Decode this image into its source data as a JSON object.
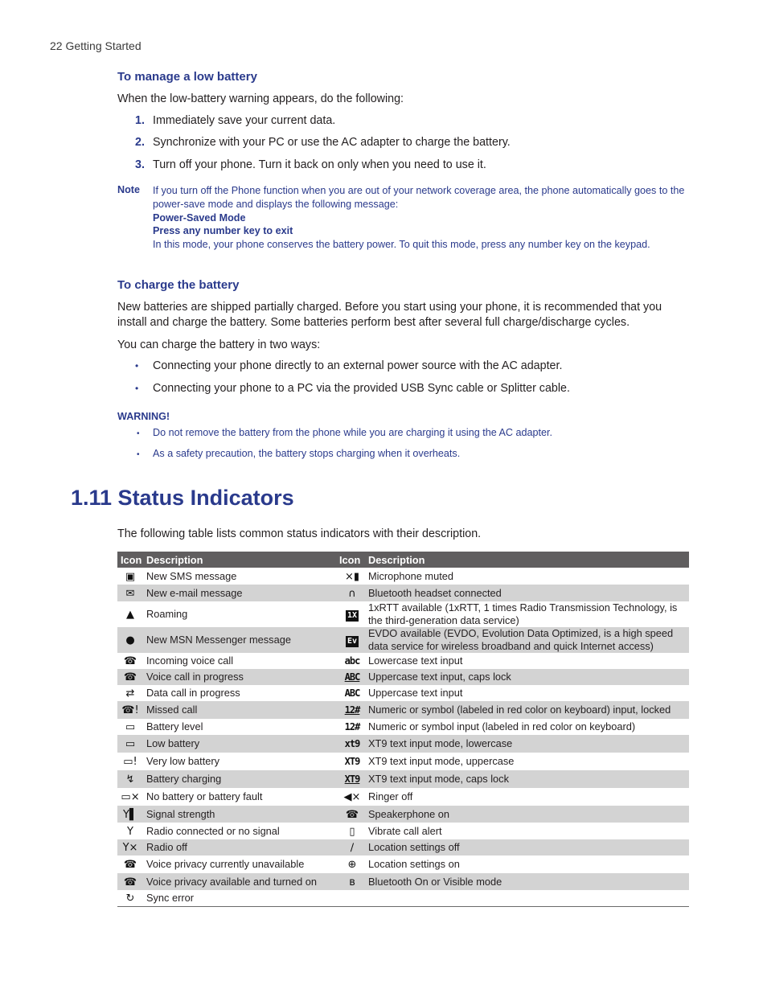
{
  "running_head": "22  Getting Started",
  "low_battery": {
    "heading": "To manage a low battery",
    "intro": "When the low-battery warning appears, do the following:",
    "steps": [
      {
        "num": "1.",
        "text": "Immediately save your current data."
      },
      {
        "num": "2.",
        "text": "Synchronize with your PC or use the AC adapter to charge the battery."
      },
      {
        "num": "3.",
        "text": "Turn off your phone. Turn it back on only when you need to use it."
      }
    ]
  },
  "note": {
    "label": "Note",
    "text": "If you turn off the Phone function when you are out of your network coverage area, the phone automatically goes to the power-save mode and displays the following message:",
    "message_line1": "Power-Saved Mode",
    "message_line2": "Press any number key to exit",
    "after": "In this mode, your phone conserves the battery power. To quit this mode, press any number key on the keypad."
  },
  "charge": {
    "heading": "To charge the battery",
    "para1": "New batteries are shipped partially charged. Before you start using your phone, it is recommended that you install and charge the battery. Some batteries perform best after several full charge/discharge cycles.",
    "para2": "You can charge the battery in two ways:",
    "bullets": [
      "Connecting your phone directly to an external power source with the AC adapter.",
      "Connecting your phone to a PC via the provided USB Sync cable or Splitter cable."
    ]
  },
  "warning": {
    "label": "WARNING!",
    "bullets": [
      "Do not remove the battery from the phone while you are charging it using the AC adapter.",
      "As a safety precaution, the battery stops charging when it overheats."
    ]
  },
  "section": {
    "title": "1.11 Status Indicators",
    "intro": "The following table lists common status indicators with their description."
  },
  "table": {
    "headers": [
      "Icon",
      "Description",
      "Icon",
      "Description"
    ],
    "rows": [
      {
        "left_icon": "new-sms-icon",
        "left": "New SMS message",
        "right_icon": "microphone-muted-icon",
        "right": "Microphone muted"
      },
      {
        "left_icon": "new-email-icon",
        "left": "New e-mail message",
        "right_icon": "bluetooth-headset-icon",
        "right": "Bluetooth headset connected"
      },
      {
        "left_icon": "roaming-icon",
        "left": "Roaming",
        "right_icon": "1xrtt-icon",
        "right": "1xRTT available (1xRTT, 1 times Radio Transmission Technology, is the third-generation data service)"
      },
      {
        "left_icon": "msn-messenger-icon",
        "left": "New MSN Messenger message",
        "right_icon": "evdo-icon",
        "right": "EVDO available (EVDO, Evolution Data Optimized, is a high speed data service for wireless broadband and quick Internet access)"
      },
      {
        "left_icon": "incoming-call-icon",
        "left": "Incoming voice call",
        "right_icon": "lowercase-abc-icon",
        "right": "Lowercase text input"
      },
      {
        "left_icon": "voice-call-progress-icon",
        "left": "Voice call in progress",
        "right_icon": "uppercase-caps-lock-icon",
        "right": "Uppercase text input, caps lock"
      },
      {
        "left_icon": "data-call-progress-icon",
        "left": "Data call in progress",
        "right_icon": "uppercase-abc-icon",
        "right": "Uppercase text input"
      },
      {
        "left_icon": "missed-call-icon",
        "left": "Missed call",
        "right_icon": "numeric-locked-icon",
        "right": "Numeric or symbol (labeled in red color on keyboard) input, locked"
      },
      {
        "left_icon": "battery-level-icon",
        "left": "Battery level",
        "right_icon": "numeric-icon",
        "right": "Numeric or symbol input (labeled in red color on keyboard)"
      },
      {
        "left_icon": "low-battery-icon",
        "left": "Low battery",
        "right_icon": "xt9-lowercase-icon",
        "right": "XT9 text input mode, lowercase"
      },
      {
        "left_icon": "very-low-battery-icon",
        "left": "Very low battery",
        "right_icon": "xt9-uppercase-icon",
        "right": "XT9 text input mode, uppercase"
      },
      {
        "left_icon": "battery-charging-icon",
        "left": "Battery charging",
        "right_icon": "xt9-caps-lock-icon",
        "right": "XT9 text input mode, caps lock"
      },
      {
        "left_icon": "battery-fault-icon",
        "left": "No battery or battery fault",
        "right_icon": "ringer-off-icon",
        "right": "Ringer off"
      },
      {
        "left_icon": "signal-strength-icon",
        "left": "Signal strength",
        "right_icon": "speakerphone-icon",
        "right": "Speakerphone on"
      },
      {
        "left_icon": "radio-connected-icon",
        "left": "Radio connected or no signal",
        "right_icon": "vibrate-icon",
        "right": "Vibrate call alert"
      },
      {
        "left_icon": "radio-off-icon",
        "left": "Radio off",
        "right_icon": "location-off-icon",
        "right": "Location settings off"
      },
      {
        "left_icon": "voice-privacy-unavailable-icon",
        "left": "Voice privacy currently unavailable",
        "right_icon": "location-on-icon",
        "right": "Location settings on"
      },
      {
        "left_icon": "voice-privacy-on-icon",
        "left": "Voice privacy available and turned on",
        "right_icon": "bluetooth-on-icon",
        "right": "Bluetooth On or Visible mode"
      },
      {
        "left_icon": "sync-error-icon",
        "left": "Sync error",
        "right_icon": "",
        "right": ""
      }
    ],
    "glyphs": {
      "lowercase-abc-icon": "abc",
      "uppercase-caps-lock-icon": "ABC",
      "uppercase-abc-icon": "ABC",
      "numeric-locked-icon": "12#",
      "numeric-icon": "12#",
      "xt9-lowercase-icon": "xt9",
      "xt9-uppercase-icon": "XT9",
      "xt9-caps-lock-icon": "XT9",
      "1xrtt-icon": "1X",
      "evdo-icon": "Ev"
    }
  },
  "colors": {
    "heading_blue": "#2a3a8c",
    "table_header": "#605e5f",
    "row_shade": "#d3d3d3"
  }
}
